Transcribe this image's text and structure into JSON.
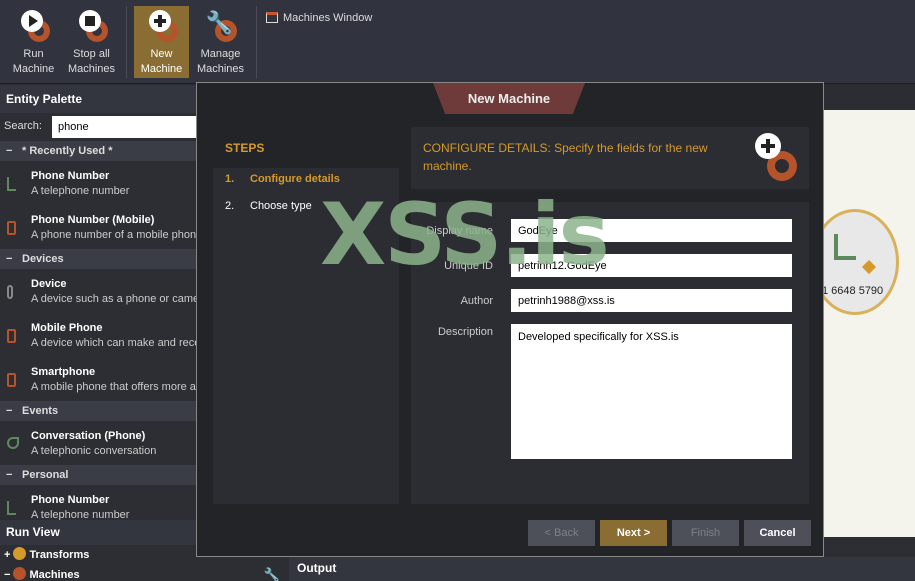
{
  "toolbar": {
    "run": [
      "Run",
      "Machine"
    ],
    "stop_all": [
      "Stop all",
      "Machines"
    ],
    "new_machine": [
      "New",
      "Machine"
    ],
    "manage": [
      "Manage",
      "Machines"
    ],
    "machines_window": "Machines Window"
  },
  "palette": {
    "title": "Entity Palette",
    "search_label": "Search:",
    "search_value": "phone",
    "sections": {
      "recent": "* Recently Used *",
      "devices": "Devices",
      "events": "Events",
      "personal": "Personal"
    },
    "items": {
      "phone_number": {
        "name": "Phone Number",
        "desc": "A telephone number"
      },
      "phone_mobile": {
        "name": "Phone Number (Mobile)",
        "desc": "A phone number of a mobile phone"
      },
      "device": {
        "name": "Device",
        "desc": "A device such as a phone or camera"
      },
      "mobile_phone": {
        "name": "Mobile Phone",
        "desc": "A device which can make and receive"
      },
      "smartphone": {
        "name": "Smartphone",
        "desc": "A mobile phone that offers more a"
      },
      "conversation": {
        "name": "Conversation (Phone)",
        "desc": "A telephonic conversation"
      },
      "personal_phone": {
        "name": "Phone Number",
        "desc": "A telephone number"
      }
    },
    "collapse_sign": "−"
  },
  "run_view": {
    "title": "Run View",
    "transforms": "Transforms",
    "machines": "Machines",
    "expand_sign": "+",
    "collapse_sign": "−"
  },
  "output": {
    "title": "Output"
  },
  "graph": {
    "label": "1  6648 5790"
  },
  "dialog": {
    "title": "New Machine",
    "steps_title": "STEPS",
    "steps": [
      {
        "num": "1.",
        "label": "Configure details"
      },
      {
        "num": "2.",
        "label": "Choose type"
      }
    ],
    "header": "CONFIGURE DETAILS: Specify the fields for the new machine.",
    "fields": {
      "display_name_label": "Display name",
      "display_name": "GodEye",
      "unique_id_label": "Unique ID",
      "unique_id": "petrinh12.GodEye",
      "author_label": "Author",
      "author": "petrinh1988@xss.is",
      "description_label": "Description",
      "description": "Developed specifically for XSS.is"
    },
    "buttons": {
      "back": "< Back",
      "next": "Next >",
      "finish": "Finish",
      "cancel": "Cancel"
    }
  },
  "watermark": "XSS.is",
  "colors": {
    "accent": "#d59a2a",
    "active_button": "#8a6d32",
    "dialog_tab": "#6e3b3a",
    "icon_red": "#b5532a"
  }
}
